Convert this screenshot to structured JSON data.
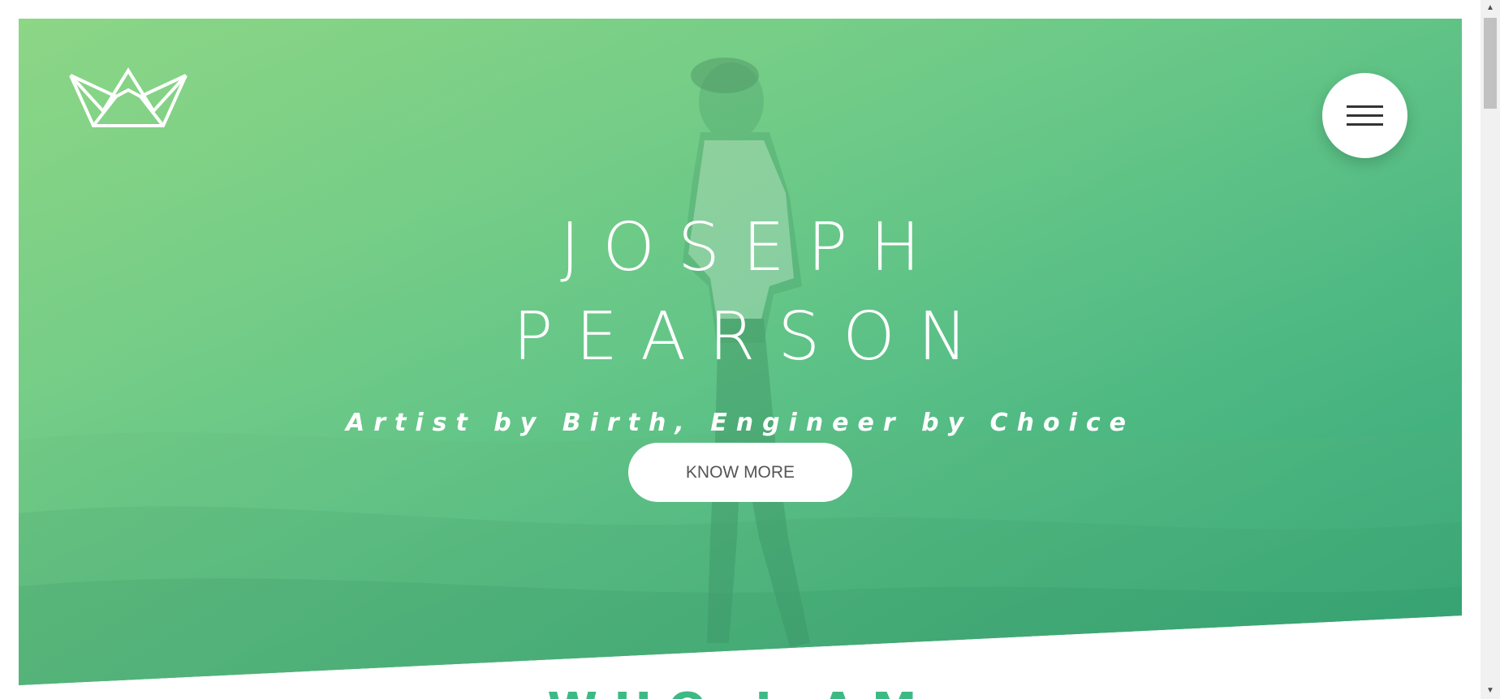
{
  "header": {
    "logo_icon": "crown-icon",
    "menu_icon": "hamburger-icon"
  },
  "hero": {
    "name_line1": "JOSEPH",
    "name_line2": "PEARSON",
    "tagline": "Artist by Birth, Engineer by Choice",
    "cta_label": "KNOW MORE"
  },
  "next_section": {
    "heading": "WHO I AM"
  },
  "colors": {
    "hero_gradient_start": "#8ad687",
    "hero_gradient_end": "#36a679",
    "accent": "#3dba84",
    "button_text": "#555555"
  }
}
